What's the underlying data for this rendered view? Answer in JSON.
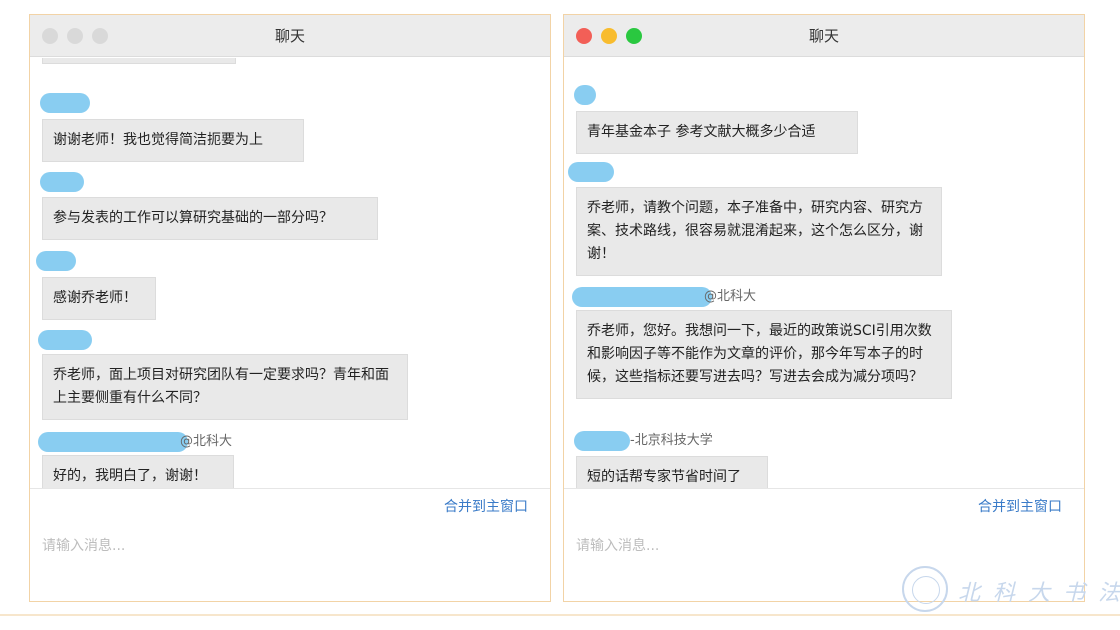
{
  "windows": [
    {
      "title": "聊天",
      "traffic_lights_active": false,
      "messages": [
        {
          "sender": "",
          "text": "谢谢老师！我也觉得简洁扼要为上"
        },
        {
          "sender": "",
          "text": "参与发表的工作可以算研究基础的一部分吗？"
        },
        {
          "sender": "",
          "text": "感谢乔老师！"
        },
        {
          "sender": "",
          "text": "乔老师，面上项目对研究团队有一定要求吗？青年和面上主要侧重有什么不同？"
        },
        {
          "sender": "@北科大",
          "text": "好的，我明白了，谢谢！"
        }
      ],
      "merge_label": "合并到主窗口",
      "input_placeholder": "请输入消息..."
    },
    {
      "title": "聊天",
      "traffic_lights_active": true,
      "messages": [
        {
          "sender": "",
          "text": "青年基金本子  参考文献大概多少合适"
        },
        {
          "sender": "",
          "text": "乔老师，请教个问题，本子准备中，研究内容、研究方案、技术路线，很容易就混淆起来，这个怎么区分，谢谢！"
        },
        {
          "sender": "@北科大",
          "text": "乔老师，您好。我想问一下，最近的政策说SCI引用次数和影响因子等不能作为文章的评价，那今年写本子的时候，这些指标还要写进去吗？写进去会成为减分项吗？"
        },
        {
          "sender": "-北京科技大学",
          "text": "短的话帮专家节省时间了"
        }
      ],
      "merge_label": "合并到主窗口",
      "input_placeholder": "请输入消息..."
    }
  ],
  "colors": {
    "bubble": "#e9e9e9",
    "link": "#3a7bc8",
    "redaction": "#7cc8ef",
    "window_border": "#f2d3a6"
  }
}
